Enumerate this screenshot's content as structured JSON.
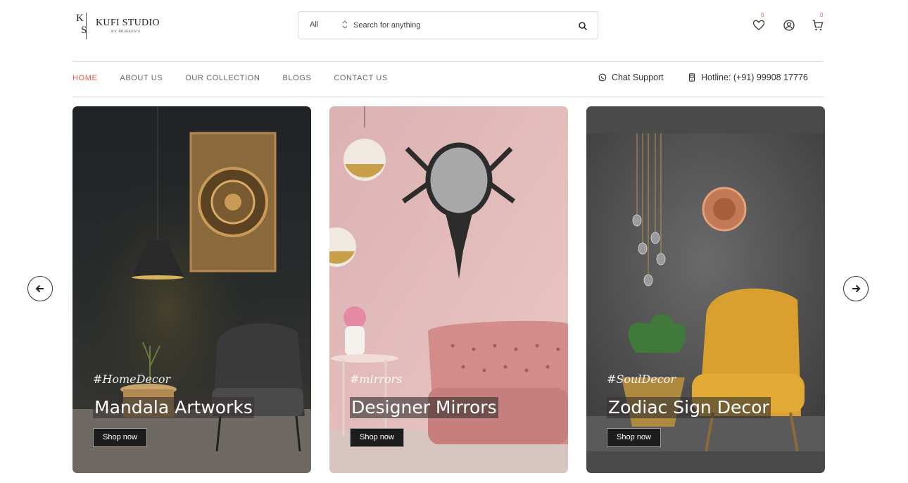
{
  "brand": {
    "monogram_top": "K",
    "monogram_bottom": "S",
    "name": "KUFI STUDIO",
    "tagline": "BY MUBEEN'S"
  },
  "search": {
    "category": "All",
    "placeholder": "Search for anything",
    "value": ""
  },
  "header_icons": [
    {
      "icon": "heart-icon",
      "badge": "0"
    },
    {
      "icon": "user-icon",
      "badge": ""
    },
    {
      "icon": "cart-icon",
      "badge": "0"
    }
  ],
  "nav": {
    "items": [
      "HOME",
      "ABOUT US",
      "OUR COLLECTION",
      "BLOGS",
      "CONTACT US"
    ],
    "active": "HOME"
  },
  "contact": {
    "chat": "Chat Support",
    "hotline": "Hotline: (+91) 99908 17776"
  },
  "cards": [
    {
      "tag": "#HomeDecor",
      "title": "Mandala Artworks",
      "button": "Shop now"
    },
    {
      "tag": "#mirrors",
      "title": "Designer Mirrors",
      "button": "Shop now"
    },
    {
      "tag": "#SoulDecor",
      "title": "Zodiac Sign Decor",
      "button": "Shop now"
    }
  ],
  "colors": {
    "accent": "#e8584a",
    "button_bg": "#1d1d1d"
  }
}
